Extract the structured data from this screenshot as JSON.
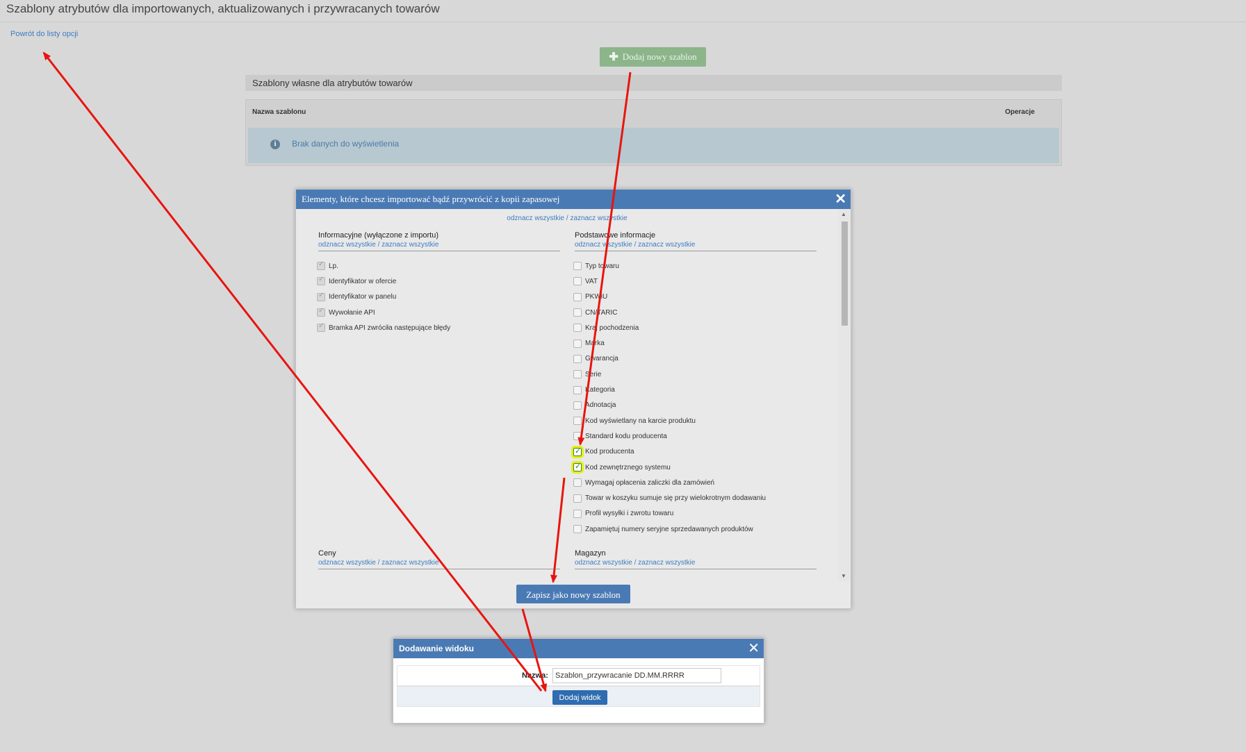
{
  "page": {
    "title": "Szablony atrybutów dla importowanych, aktualizowanych i przywracanych towarów",
    "back_link": "Powrót do listy opcji",
    "add_template_button": "Dodaj nowy szablon",
    "section_header": "Szablony własne dla atrybutów towarów",
    "table": {
      "columns": [
        "Nazwa szablonu",
        "Operacje"
      ],
      "empty_message": "Brak danych do wyświetlenia"
    }
  },
  "dialog": {
    "title": "Elementy, które chcesz importować bądź przywrócić z kopii zapasowej",
    "toggle_all": "odznacz wszystkie / zaznacz wszystkie",
    "columns": [
      {
        "title": "Informacyjne (wyłączone z importu)",
        "toggle": "odznacz wszystkie / zaznacz wszystkie",
        "items": [
          {
            "label": "Lp.",
            "state": "disabled-checked"
          },
          {
            "label": "Identyfikator w ofercie",
            "state": "disabled-checked"
          },
          {
            "label": "Identyfikator w panelu",
            "state": "disabled-checked"
          },
          {
            "label": "Wywołanie API",
            "state": "disabled-checked"
          },
          {
            "label": "Bramka API zwróciła następujące błędy",
            "state": "disabled-checked"
          }
        ]
      },
      {
        "title": "Podstawowe informacje",
        "toggle": "odznacz wszystkie / zaznacz wszystkie",
        "items": [
          {
            "label": "Typ towaru",
            "state": "unchecked"
          },
          {
            "label": "VAT",
            "state": "unchecked"
          },
          {
            "label": "PKWiU",
            "state": "unchecked"
          },
          {
            "label": "CN/TARIC",
            "state": "unchecked"
          },
          {
            "label": "Kraj pochodzenia",
            "state": "unchecked"
          },
          {
            "label": "Marka",
            "state": "unchecked"
          },
          {
            "label": "Gwarancja",
            "state": "unchecked"
          },
          {
            "label": "Serie",
            "state": "unchecked"
          },
          {
            "label": "Kategoria",
            "state": "unchecked"
          },
          {
            "label": "Adnotacja",
            "state": "unchecked"
          },
          {
            "label": "Kod wyświetlany na karcie produktu",
            "state": "unchecked"
          },
          {
            "label": "Standard kodu producenta",
            "state": "unchecked"
          },
          {
            "label": "Kod producenta",
            "state": "checked"
          },
          {
            "label": "Kod zewnętrznego systemu",
            "state": "checked"
          },
          {
            "label": "Wymagaj opłacenia zaliczki dla zamówień",
            "state": "unchecked"
          },
          {
            "label": "Towar w koszyku sumuje się przy wielokrotnym dodawaniu",
            "state": "unchecked"
          },
          {
            "label": "Profil wysyłki i zwrotu towaru",
            "state": "unchecked"
          },
          {
            "label": "Zapamiętuj numery seryjne sprzedawanych produktów",
            "state": "unchecked"
          }
        ]
      },
      {
        "title": "Ceny",
        "toggle": "odznacz wszystkie / zaznacz wszystkie"
      },
      {
        "title": "Magazyn",
        "toggle": "odznacz wszystkie / zaznacz wszystkie"
      }
    ],
    "save_button": "Zapisz jako nowy szablon"
  },
  "dialog2": {
    "title": "Dodawanie widoku",
    "name_label": "Nazwa:",
    "name_value": "Szablon_przywracanie DD.MM.RRRR",
    "add_button": "Dodaj widok"
  },
  "colors": {
    "accent_blue": "#4a7ab4",
    "add_button_green": "#8cb58a",
    "annotation_red": "#e8140f",
    "highlight_yellow": "#e6ee16"
  }
}
